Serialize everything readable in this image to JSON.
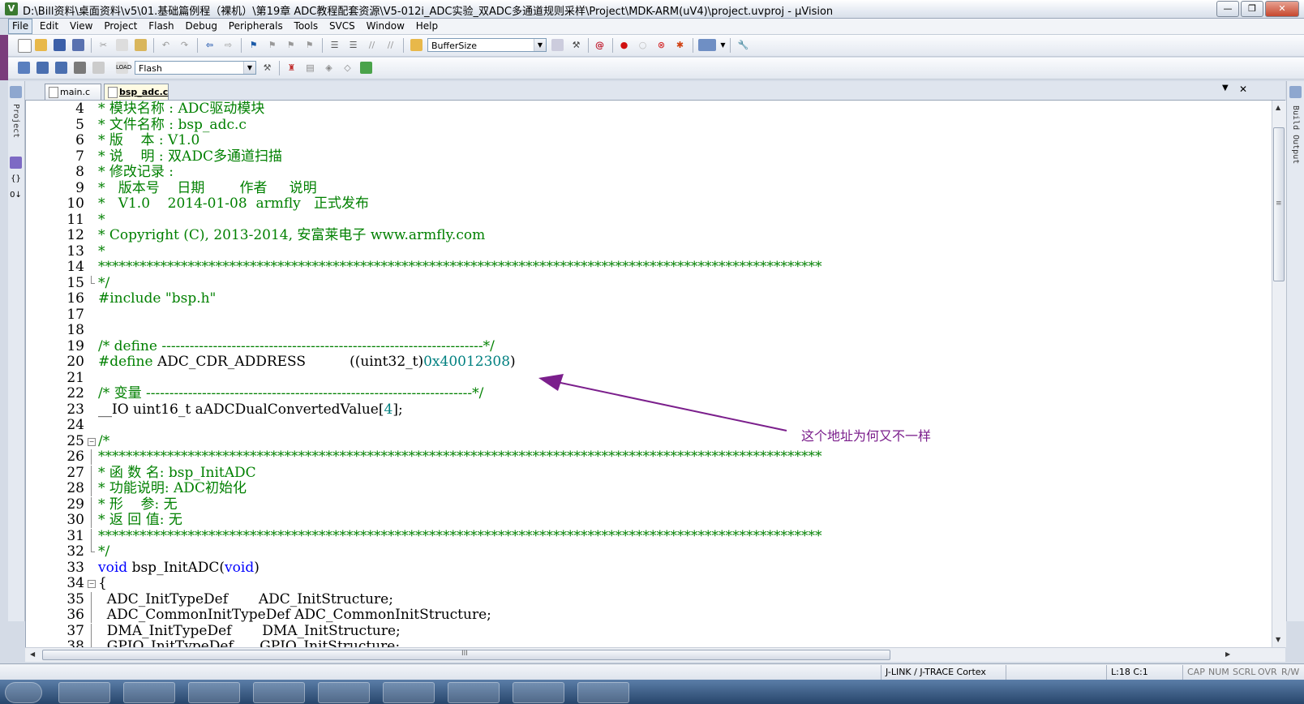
{
  "window": {
    "title": "D:\\Bill资料\\桌面资料\\v5\\01.基础篇例程（裸机）\\第19章 ADC教程配套资源\\V5-012i_ADC实验_双ADC多通道规则采样\\Project\\MDK-ARM(uV4)\\project.uvproj - µVision",
    "app_icon": "V",
    "minimize": "—",
    "restore": "❐",
    "close": "✕"
  },
  "menu": {
    "items": [
      "File",
      "Edit",
      "View",
      "Project",
      "Flash",
      "Debug",
      "Peripherals",
      "Tools",
      "SVCS",
      "Window",
      "Help"
    ]
  },
  "toolbar1": {
    "find_combo": "BufferSize"
  },
  "toolbar2": {
    "target_combo": "Flash"
  },
  "left_dock": {
    "project_label": "Project"
  },
  "right_dock": {
    "build_output_label": "Build Output"
  },
  "tabs": [
    {
      "label": "main.c",
      "active": false
    },
    {
      "label": "bsp_adc.c",
      "active": true
    }
  ],
  "tab_controls": {
    "dropdown": "▼",
    "close": "✕"
  },
  "editor": {
    "lines": [
      {
        "num": "4",
        "fold": "",
        "text": "* 模块名称 : ADC驱动模块",
        "style": "c"
      },
      {
        "num": "5",
        "fold": "",
        "text": "* 文件名称 : bsp_adc.c",
        "style": "c"
      },
      {
        "num": "6",
        "fold": "",
        "text": "* 版    本 : V1.0",
        "style": "c"
      },
      {
        "num": "7",
        "fold": "",
        "text": "* 说    明 : 双ADC多通道扫描",
        "style": "c"
      },
      {
        "num": "8",
        "fold": "",
        "text": "* 修改记录 :",
        "style": "c"
      },
      {
        "num": "9",
        "fold": "",
        "text": "*   版本号    日期        作者     说明",
        "style": "c"
      },
      {
        "num": "10",
        "fold": "",
        "text": "*   V1.0    2014-01-08  armfly   正式发布",
        "style": "c"
      },
      {
        "num": "11",
        "fold": "",
        "text": "*",
        "style": "c"
      },
      {
        "num": "12",
        "fold": "",
        "text": "* Copyright (C), 2013-2014, 安富莱电子 www.armfly.com",
        "style": "c"
      },
      {
        "num": "13",
        "fold": "",
        "text": "*",
        "style": "c"
      },
      {
        "num": "14",
        "fold": "",
        "text": "*********************************************************************************************************",
        "style": "c"
      },
      {
        "num": "15",
        "fold": "end",
        "text": "*/",
        "style": "c"
      },
      {
        "num": "16",
        "fold": "",
        "text": "#include \"bsp.h\"",
        "style": "inc"
      },
      {
        "num": "17",
        "fold": "",
        "text": "",
        "style": ""
      },
      {
        "num": "18",
        "fold": "",
        "text": "",
        "style": ""
      },
      {
        "num": "19",
        "fold": "",
        "text": "/* define ---------------------------------------------------------------------*/",
        "style": "c"
      },
      {
        "num": "20",
        "fold": "",
        "text": "#define ADC_CDR_ADDRESS          ((uint32_t)0x40012308)",
        "style": "def"
      },
      {
        "num": "21",
        "fold": "",
        "text": "",
        "style": ""
      },
      {
        "num": "22",
        "fold": "",
        "text": "/* 变量 ----------------------------------------------------------------------*/",
        "style": "c"
      },
      {
        "num": "23",
        "fold": "",
        "text": "__IO uint16_t aADCDualConvertedValue[4];",
        "style": "var"
      },
      {
        "num": "24",
        "fold": "",
        "text": "",
        "style": ""
      },
      {
        "num": "25",
        "fold": "start",
        "text": "/*",
        "style": "c"
      },
      {
        "num": "26",
        "fold": "mid",
        "text": "*********************************************************************************************************",
        "style": "c"
      },
      {
        "num": "27",
        "fold": "mid",
        "text": "* 函 数 名: bsp_InitADC",
        "style": "c"
      },
      {
        "num": "28",
        "fold": "mid",
        "text": "* 功能说明: ADC初始化",
        "style": "c"
      },
      {
        "num": "29",
        "fold": "mid",
        "text": "* 形    参: 无",
        "style": "c"
      },
      {
        "num": "30",
        "fold": "mid",
        "text": "* 返 回 值: 无",
        "style": "c"
      },
      {
        "num": "31",
        "fold": "mid",
        "text": "*********************************************************************************************************",
        "style": "c"
      },
      {
        "num": "32",
        "fold": "end",
        "text": "*/",
        "style": "c"
      },
      {
        "num": "33",
        "fold": "",
        "text": "void bsp_InitADC(void)",
        "style": "func"
      },
      {
        "num": "34",
        "fold": "start",
        "text": "{",
        "style": ""
      },
      {
        "num": "35",
        "fold": "mid",
        "text": "  ADC_InitTypeDef       ADC_InitStructure;",
        "style": ""
      },
      {
        "num": "36",
        "fold": "mid",
        "text": "  ADC_CommonInitTypeDef ADC_CommonInitStructure;",
        "style": ""
      },
      {
        "num": "37",
        "fold": "mid",
        "text": "  DMA_InitTypeDef       DMA_InitStructure;",
        "style": ""
      },
      {
        "num": "38",
        "fold": "mid",
        "text": "  GPIO_InitTypeDef      GPIO_InitStructure;",
        "style": ""
      }
    ]
  },
  "annotation": {
    "text": "这个地址为何又不一样",
    "color": "#7b1f8c"
  },
  "status": {
    "debugger": "J-LINK / J-TRACE Cortex",
    "position": "L:18 C:1",
    "cap": "CAP",
    "num": "NUM",
    "scrl": "SCRL",
    "ovr": "OVR",
    "rw": "R/W"
  },
  "scroll": {
    "h_mid": "III",
    "v_mid": "≡"
  }
}
